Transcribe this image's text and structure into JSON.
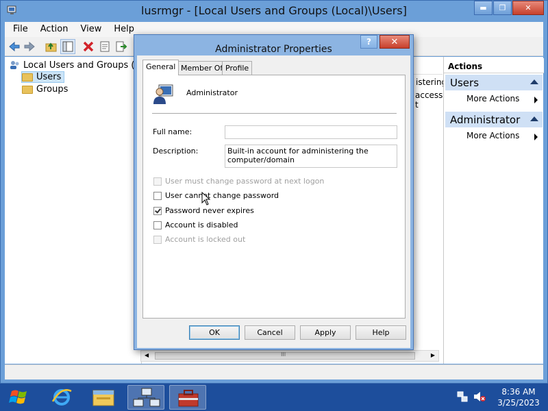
{
  "window": {
    "title": "lusrmgr - [Local Users and Groups (Local)\\Users]",
    "controls": {
      "minimize": "▬",
      "maximize": "❐",
      "close": "✕"
    }
  },
  "menubar": {
    "items": [
      "File",
      "Action",
      "View",
      "Help"
    ]
  },
  "toolbar": {
    "icons": [
      "back-icon",
      "forward-icon",
      "up-folder-icon",
      "show-hide-tree-icon",
      "delete-icon",
      "properties-icon",
      "export-list-icon"
    ]
  },
  "tree": {
    "root": "Local Users and Groups (Local)",
    "items": [
      "Users",
      "Groups"
    ]
  },
  "middle_pane": {
    "partial_text_1": "istering",
    "partial_text_2": "access t",
    "scroll_grip": "III"
  },
  "actions": {
    "header": "Actions",
    "sections": [
      {
        "title": "Users",
        "item": "More Actions"
      },
      {
        "title": "Administrator",
        "item": "More Actions"
      }
    ]
  },
  "dialog": {
    "title": "Administrator Properties",
    "help_button": "?",
    "close_button": "✕",
    "tabs": [
      "General",
      "Member Of",
      "Profile"
    ],
    "active_tab": "General",
    "user_name": "Administrator",
    "full_name_label": "Full name:",
    "full_name_value": "",
    "description_label": "Description:",
    "description_value": "Built-in account for administering the computer/domain",
    "checkboxes": [
      {
        "label": "User must change password at next logon",
        "checked": false,
        "disabled": true
      },
      {
        "label": "User cannot change password",
        "checked": false,
        "disabled": false
      },
      {
        "label": "Password never expires",
        "checked": true,
        "disabled": false
      },
      {
        "label": "Account is disabled",
        "checked": false,
        "disabled": false
      },
      {
        "label": "Account is locked out",
        "checked": false,
        "disabled": true
      }
    ],
    "buttons": {
      "ok": "OK",
      "cancel": "Cancel",
      "apply": "Apply",
      "help": "Help"
    }
  },
  "taskbar": {
    "apps": [
      "windows-logo-icon",
      "internet-explorer-icon",
      "file-explorer-icon",
      "network-icon",
      "toolbox-icon"
    ],
    "time": "8:36 AM",
    "date": "3/25/2023"
  },
  "colors": {
    "taskbar": "#1d4e9c",
    "window_frame": "#6b9fd8",
    "actions_section": "#cfe0f5",
    "tree_selection": "#cce4f7"
  }
}
